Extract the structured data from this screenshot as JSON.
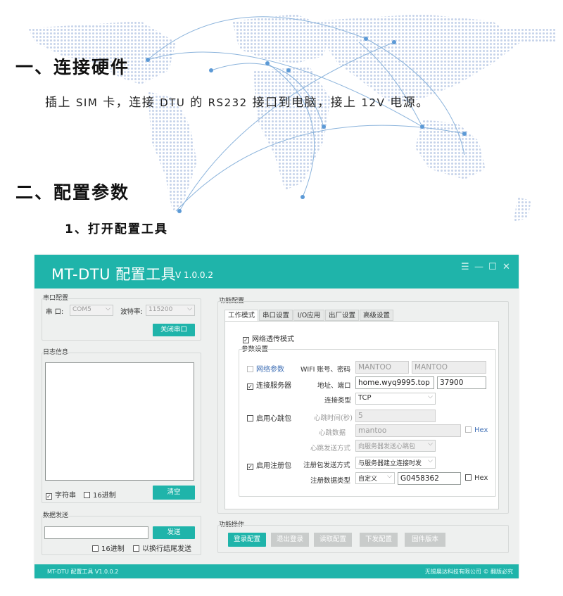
{
  "doc": {
    "heading1": "一、连接硬件",
    "para": [
      "插上 ",
      "SIM",
      " 卡，连接 ",
      "DTU",
      " 的 ",
      "RS232",
      " 接口到电脑，接上 ",
      "12V",
      " 电源。"
    ],
    "heading2": "二、配置参数",
    "heading3": "1、打开配置工具"
  },
  "app": {
    "title": "MT-DTU 配置工具",
    "version": "V 1.0.0.2",
    "window_controls": [
      "☰",
      "—",
      "☐",
      "✕"
    ],
    "serial": {
      "group": "串口配置",
      "port_label": "串  口:",
      "port_value": "COM5",
      "baud_label": "波特率:",
      "baud_value": "115200",
      "close_button": "关闭串口"
    },
    "log": {
      "group": "日志信息",
      "char_check": "字符串",
      "hex_check": "16进制",
      "clear_button": "清空"
    },
    "send": {
      "group": "数据发送",
      "send_button": "发送",
      "hex_check": "16进制",
      "newline_check": "以换行结尾发送"
    },
    "func": {
      "group": "功能配置",
      "tabs": [
        "工作模式",
        "串口设置",
        "I/O应用",
        "出厂设置",
        "高级设置"
      ],
      "transparent_mode": "网络透传模式",
      "params_group": "参数设置",
      "net_param": "网络参数",
      "wifi_label": "WIFI 账号、密码",
      "wifi_user": "MANTOO",
      "wifi_pass": "MANTOO",
      "connect_server": "连接服务器",
      "addr_label": "地址、端口",
      "addr_value": "home.wyq9995.top",
      "port_value": "37900",
      "conn_type_label": "连接类型",
      "conn_type_value": "TCP",
      "heartbeat": "启用心跳包",
      "hb_time_label": "心跳时间(秒)",
      "hb_time_value": "5",
      "hb_data_label": "心跳数据",
      "hb_data_value": "mantoo",
      "hb_hex": "Hex",
      "hb_mode_label": "心跳发送方式",
      "hb_mode_value": "向服务器发送心跳包",
      "register": "启用注册包",
      "reg_mode_label": "注册包发送方式",
      "reg_mode_value": "与服务器建立连接时发",
      "reg_type_label": "注册数据类型",
      "reg_type_value": "自定义",
      "reg_data_value": "G0458362",
      "reg_hex": "Hex"
    },
    "ops": {
      "group": "功能操作",
      "buttons": [
        "登录配置",
        "退出登录",
        "读取配置",
        "下发配置",
        "固件版本"
      ]
    },
    "status_left": "MT-DTU 配置工具  V1.0.0.2",
    "status_right": "无锡晨达科技有限公司 © 翻版必究",
    "accent": "#1fb4aa"
  }
}
